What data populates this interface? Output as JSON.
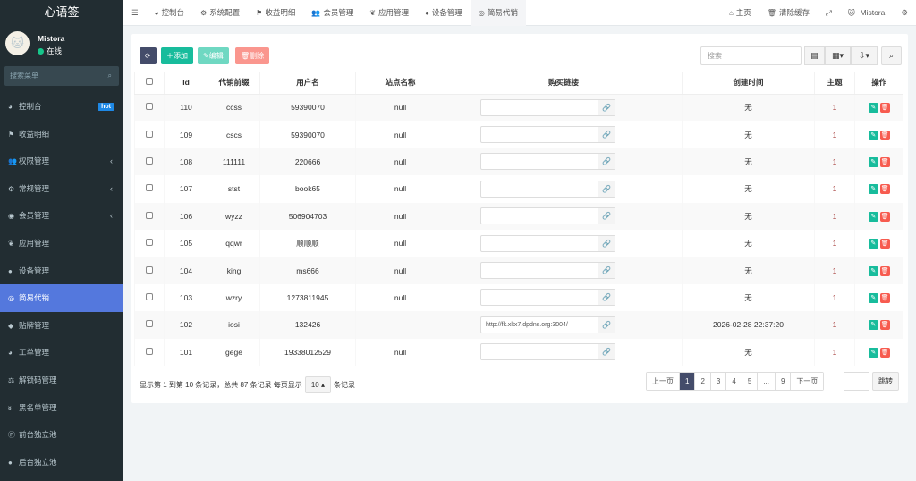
{
  "app": {
    "title": "心语签"
  },
  "user": {
    "name": "Mistora",
    "status": "在线"
  },
  "sidebar": {
    "search_placeholder": "搜索菜单",
    "items": [
      {
        "label": "控制台",
        "icon": "dashboard-icon",
        "badge": "hot"
      },
      {
        "label": "收益明细",
        "icon": "flag-icon"
      },
      {
        "label": "权限管理",
        "icon": "group-icon",
        "arrow": true
      },
      {
        "label": "常规管理",
        "icon": "cogs-icon",
        "arrow": true
      },
      {
        "label": "会员管理",
        "icon": "user-circle-icon",
        "arrow": true
      },
      {
        "label": "应用管理",
        "icon": "leaf-icon"
      },
      {
        "label": "设备管理",
        "icon": "device-icon"
      },
      {
        "label": "简易代销",
        "icon": "globe-icon",
        "active": true
      },
      {
        "label": "贴牌管理",
        "icon": "tags-icon"
      },
      {
        "label": "工单管理",
        "icon": "dashboard-icon"
      },
      {
        "label": "解锁码管理",
        "icon": "balance-scale-icon"
      },
      {
        "label": "黑名单管理",
        "icon": "bicycle-icon"
      },
      {
        "label": "前台独立池",
        "icon": "parking-icon"
      },
      {
        "label": "后台独立池",
        "icon": "apple-icon"
      }
    ]
  },
  "topnav": {
    "tabs": [
      {
        "label": "控制台",
        "icon": "dashboard-icon"
      },
      {
        "label": "系统配置",
        "icon": "gear-icon"
      },
      {
        "label": "收益明细",
        "icon": "flag-icon"
      },
      {
        "label": "会员管理",
        "icon": "group-icon"
      },
      {
        "label": "应用管理",
        "icon": "leaf-icon"
      },
      {
        "label": "设备管理",
        "icon": "device-icon"
      },
      {
        "label": "简易代销",
        "icon": "globe-icon",
        "active": true
      }
    ],
    "home": "主页",
    "clear_cache": "清除缓存",
    "user": "Mistora"
  },
  "toolbar": {
    "add": "添加",
    "edit": "编辑",
    "delete": "删除",
    "search_placeholder": "搜索"
  },
  "table": {
    "columns": [
      "Id",
      "代销前缀",
      "用户名",
      "站点名称",
      "购买链接",
      "创建时间",
      "主题",
      "操作"
    ],
    "rows": [
      {
        "id": "110",
        "prefix": "ccss",
        "user": "59390070",
        "site": "null",
        "link": "",
        "created": "无",
        "theme": "1"
      },
      {
        "id": "109",
        "prefix": "cscs",
        "user": "59390070",
        "site": "null",
        "link": "",
        "created": "无",
        "theme": "1"
      },
      {
        "id": "108",
        "prefix": "111111",
        "user": "220666",
        "site": "null",
        "link": "",
        "created": "无",
        "theme": "1"
      },
      {
        "id": "107",
        "prefix": "stst",
        "user": "book65",
        "site": "null",
        "link": "",
        "created": "无",
        "theme": "1"
      },
      {
        "id": "106",
        "prefix": "wyzz",
        "user": "506904703",
        "site": "null",
        "link": "",
        "created": "无",
        "theme": "1"
      },
      {
        "id": "105",
        "prefix": "qqwr",
        "user": "顺顺顺",
        "site": "null",
        "link": "",
        "created": "无",
        "theme": "1"
      },
      {
        "id": "104",
        "prefix": "king",
        "user": "ms666",
        "site": "null",
        "link": "",
        "created": "无",
        "theme": "1"
      },
      {
        "id": "103",
        "prefix": "wzry",
        "user": "1273811945",
        "site": "null",
        "link": "",
        "created": "无",
        "theme": "1"
      },
      {
        "id": "102",
        "prefix": "iosi",
        "user": "132426",
        "site": "",
        "link": "http://fk.xltx7.dpdns.org:3004/",
        "created": "2026-02-28 22:37:20",
        "theme": "1"
      },
      {
        "id": "101",
        "prefix": "gege",
        "user": "19338012529",
        "site": "null",
        "link": "",
        "created": "无",
        "theme": "1"
      }
    ]
  },
  "footer": {
    "summary": "显示第 1 到第 10 条记录，总共 87 条记录 每页显示",
    "page_size": "10",
    "suffix": "条记录"
  },
  "pagination": {
    "prev": "上一页",
    "pages": [
      "1",
      "2",
      "3",
      "4",
      "5",
      "...",
      "9"
    ],
    "current": "1",
    "next": "下一页",
    "jump": "跳转"
  },
  "colors": {
    "sidebar": "#222d32",
    "active": "#5478dd",
    "add": "#18bc9c",
    "delete": "#f75b4f",
    "refresh": "#444c6a"
  }
}
